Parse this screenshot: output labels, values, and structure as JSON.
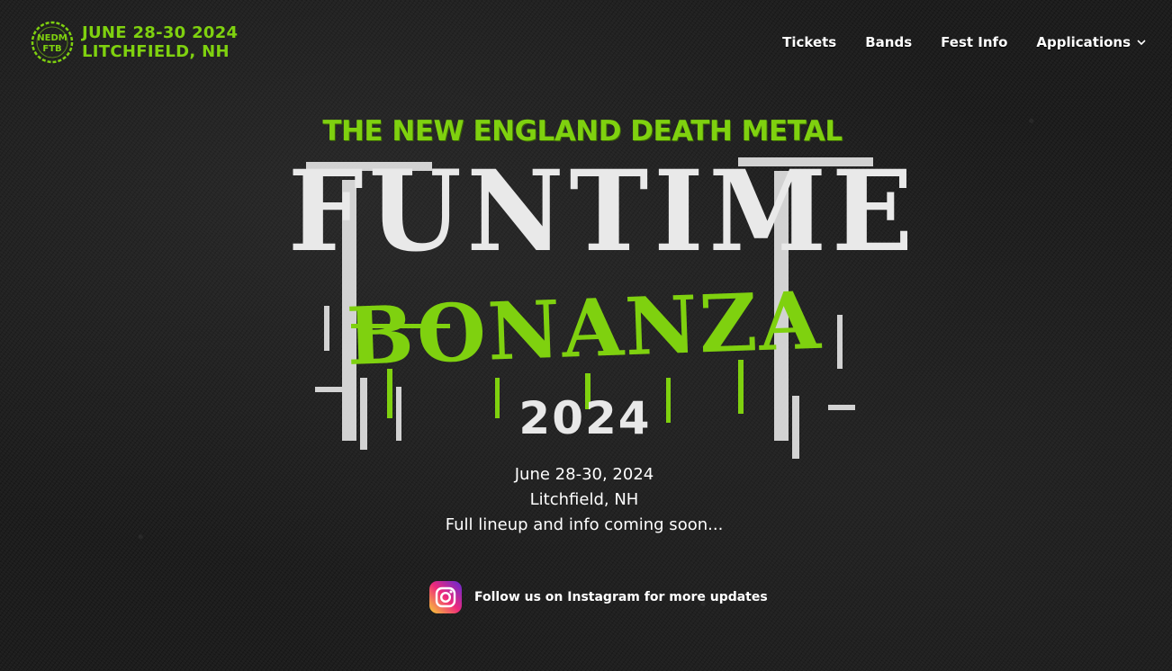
{
  "header": {
    "brand": {
      "logo_icon": "nedm-ftb-logo-icon",
      "line1": "JUNE 28-30 2024",
      "line2": "LITCHFIELD, NH",
      "accent_color": "#7fd10f"
    },
    "nav": [
      {
        "label": "Tickets"
      },
      {
        "label": "Bands"
      },
      {
        "label": "Fest Info"
      },
      {
        "label": "Applications",
        "icon": "chevron-down-icon"
      }
    ]
  },
  "hero": {
    "logo_title": "THE NEW ENGLAND DEATH METAL",
    "logo_main": "FUNTIME",
    "logo_sub": "BONANZA",
    "logo_year": "2024"
  },
  "info": {
    "dates": "June 28-30, 2024",
    "location": "Litchfield, NH",
    "note": "Full lineup and info coming soon..."
  },
  "social": {
    "icon": "instagram-icon",
    "label": "Follow us on Instagram for more updates"
  }
}
